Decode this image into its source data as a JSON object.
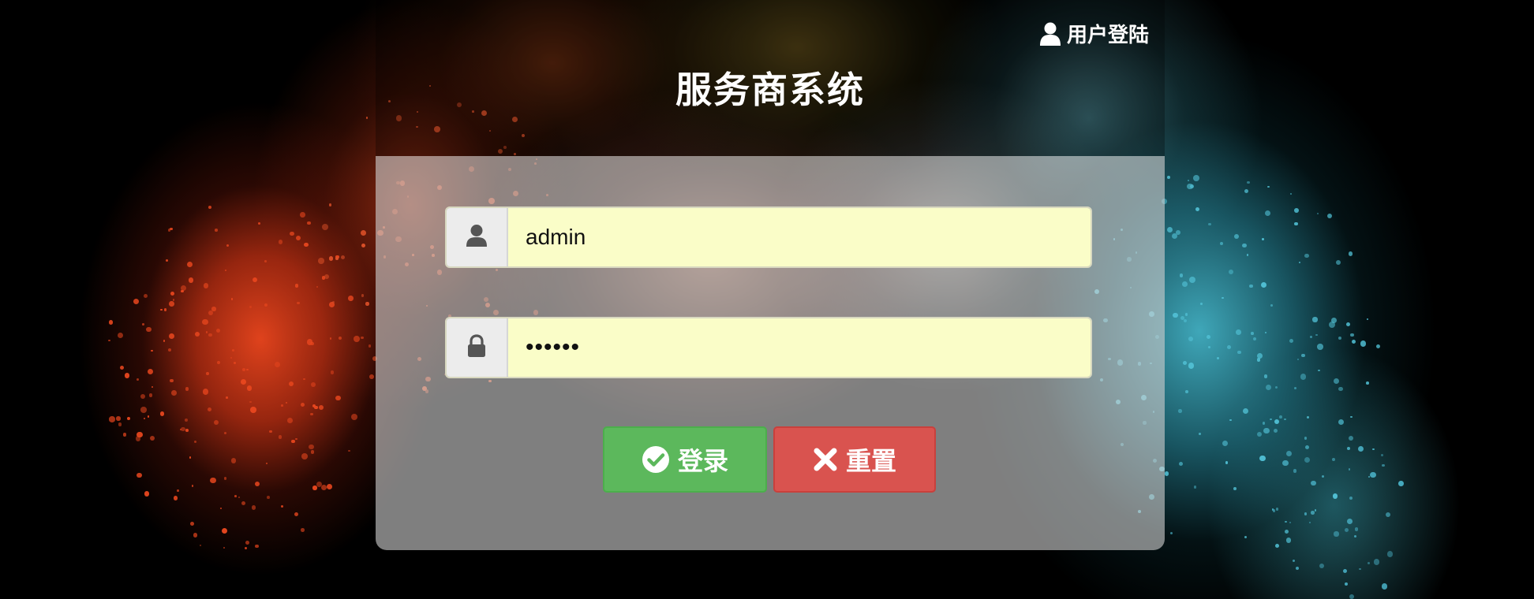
{
  "header": {
    "login_label": "用户登陆",
    "title": "服务商系统"
  },
  "form": {
    "username": {
      "value": "admin",
      "icon": "user-icon"
    },
    "password": {
      "value": "••••••",
      "icon": "lock-icon"
    }
  },
  "buttons": {
    "login": {
      "label": "登录",
      "icon": "check-circle-icon",
      "color": "#5cb85c"
    },
    "reset": {
      "label": "重置",
      "icon": "times-icon",
      "color": "#d9534f"
    }
  },
  "colors": {
    "input_bg": "#fafdc8",
    "panel_bg": "rgba(205,205,205,0.62)"
  }
}
